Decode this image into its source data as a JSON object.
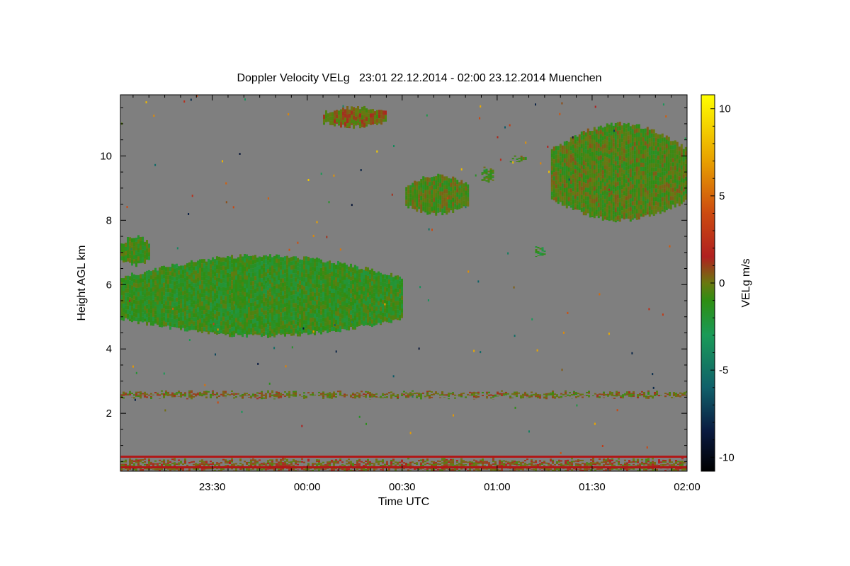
{
  "chart_data": {
    "type": "heatmap",
    "title": "Doppler Velocity VELg   23:01 22.12.2014 - 02:00 23.12.2014 Muenchen",
    "xlabel": "Time UTC",
    "ylabel": "Height AGL km",
    "colorbar_label": "VELg m/s",
    "x_range_minutes_from_2300": [
      1,
      180
    ],
    "x_ticks": [
      {
        "minutes_from_2300": 30,
        "label": "23:30"
      },
      {
        "minutes_from_2300": 60,
        "label": "00:00"
      },
      {
        "minutes_from_2300": 90,
        "label": "00:30"
      },
      {
        "minutes_from_2300": 120,
        "label": "01:00"
      },
      {
        "minutes_from_2300": 150,
        "label": "01:30"
      },
      {
        "minutes_from_2300": 180,
        "label": "02:00"
      }
    ],
    "y_range_km": [
      0.2,
      11.9
    ],
    "y_ticks": [
      {
        "value": 2,
        "label": "2"
      },
      {
        "value": 4,
        "label": "4"
      },
      {
        "value": 6,
        "label": "6"
      },
      {
        "value": 8,
        "label": "8"
      },
      {
        "value": 10,
        "label": "10"
      }
    ],
    "colorbar_range": [
      -10.8,
      10.8
    ],
    "colorbar_ticks": [
      {
        "value": 10,
        "label": "10"
      },
      {
        "value": 5,
        "label": "5"
      },
      {
        "value": 0,
        "label": "0"
      },
      {
        "value": -5,
        "label": "-5"
      },
      {
        "value": -10,
        "label": "-10"
      }
    ],
    "colorbar_stops": [
      {
        "value": -10.8,
        "color": "#000000"
      },
      {
        "value": -8.5,
        "color": "#0a1a40"
      },
      {
        "value": -6.0,
        "color": "#10606a"
      },
      {
        "value": -3.0,
        "color": "#1a9a58"
      },
      {
        "value": -1.0,
        "color": "#2e8e12"
      },
      {
        "value": 0.0,
        "color": "#6a7810"
      },
      {
        "value": 1.5,
        "color": "#b02020"
      },
      {
        "value": 4.0,
        "color": "#cc4a10"
      },
      {
        "value": 7.0,
        "color": "#e8a000"
      },
      {
        "value": 10.8,
        "color": "#ffff00"
      }
    ],
    "background_color": "#7f7f7f",
    "cloud_regions": [
      {
        "t0": 1,
        "t1": 90,
        "h0": 4.4,
        "h1": 6.9,
        "mean_velocity": -1.2
      },
      {
        "t0": 1,
        "t1": 10,
        "h0": 6.6,
        "h1": 7.5,
        "mean_velocity": -1.0
      },
      {
        "t0": 91,
        "t1": 111,
        "h0": 8.2,
        "h1": 9.4,
        "mean_velocity": -0.6
      },
      {
        "t0": 115,
        "t1": 119,
        "h0": 9.2,
        "h1": 9.6,
        "mean_velocity": -0.8
      },
      {
        "t0": 124,
        "t1": 129,
        "h0": 9.8,
        "h1": 10.0,
        "mean_velocity": -0.6
      },
      {
        "t0": 132,
        "t1": 135,
        "h0": 6.9,
        "h1": 7.2,
        "mean_velocity": -1.5
      },
      {
        "t0": 65,
        "t1": 85,
        "h0": 10.9,
        "h1": 11.5,
        "mean_velocity": 0.3
      },
      {
        "t0": 137,
        "t1": 180,
        "h0": 8.0,
        "h1": 11.0,
        "mean_velocity": -0.5
      },
      {
        "t0": 1,
        "t1": 180,
        "h0": 0.2,
        "h1": 0.55,
        "mean_velocity": 0.5
      },
      {
        "t0": 1,
        "t1": 180,
        "h0": 2.5,
        "h1": 2.65,
        "mean_velocity": 0.2
      }
    ],
    "surface_lines_km": [
      0.32,
      0.65
    ],
    "grid": false
  }
}
